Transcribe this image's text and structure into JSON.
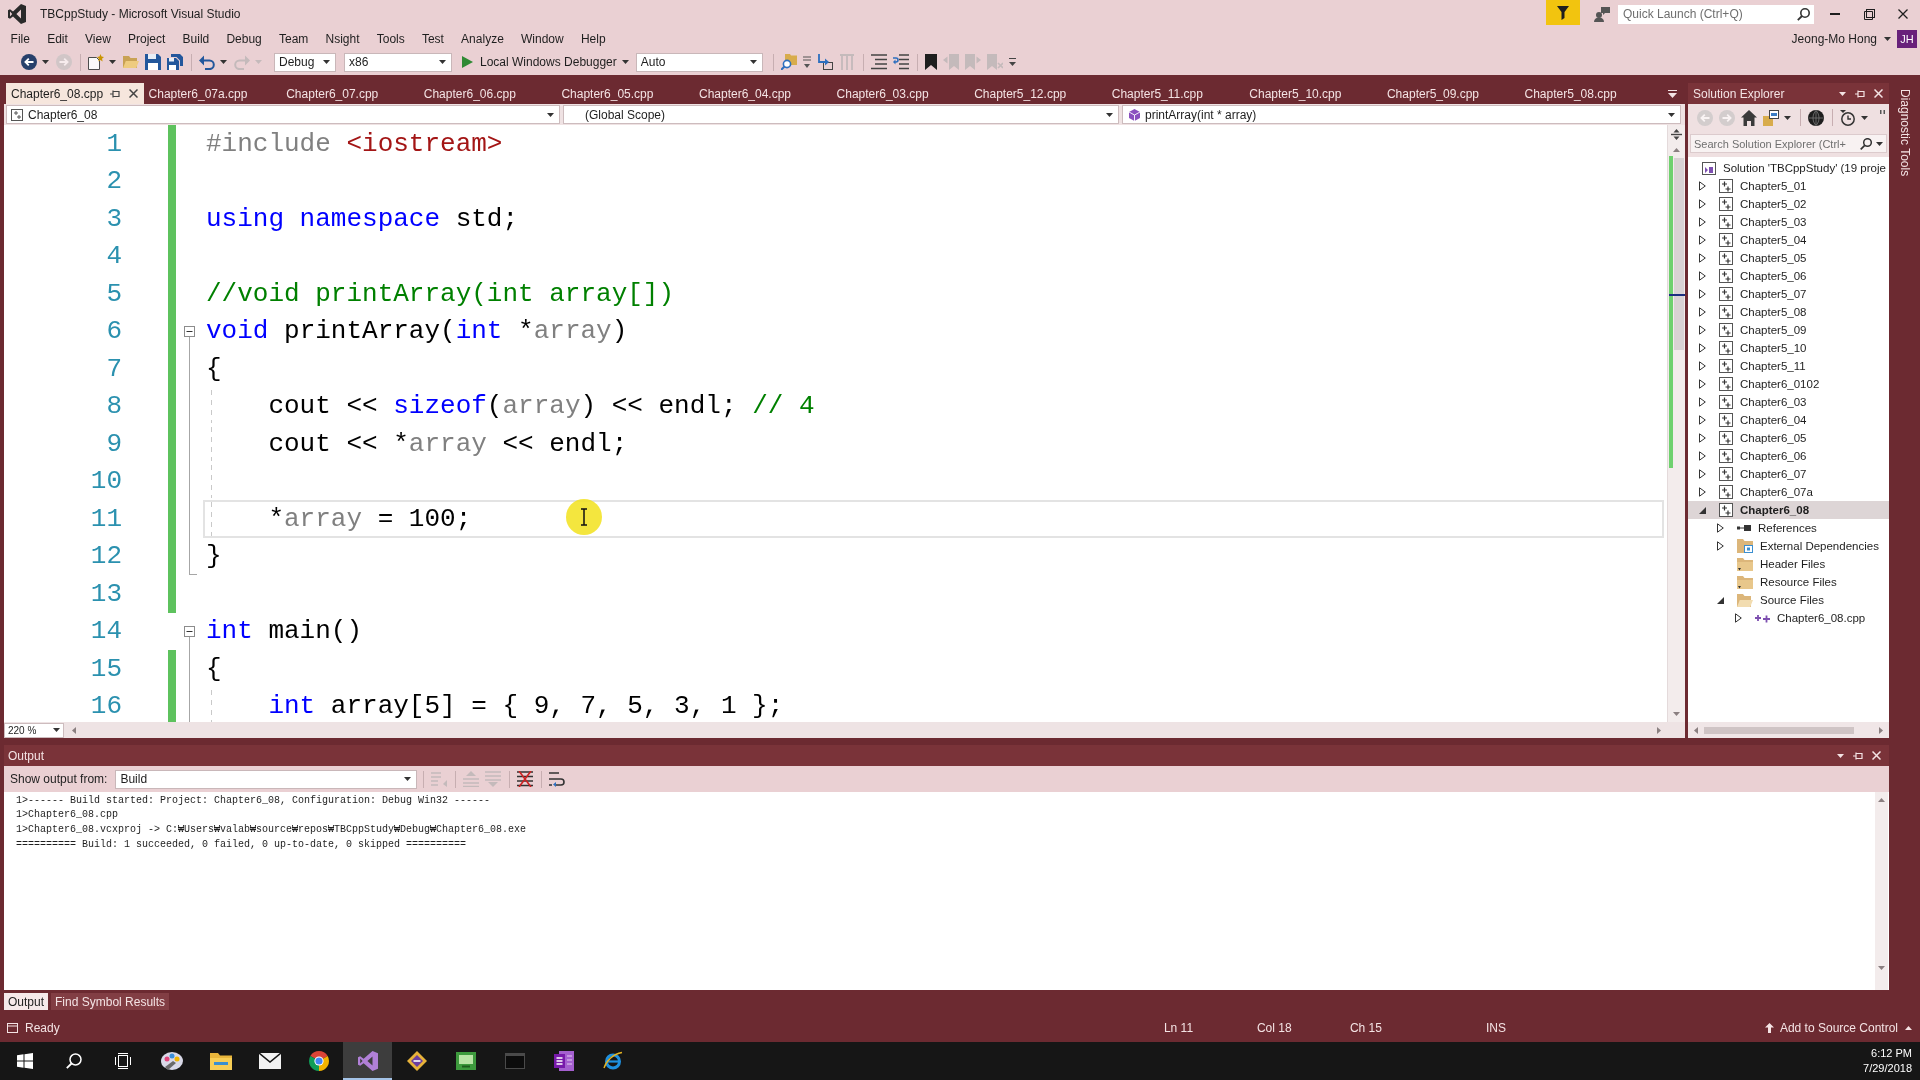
{
  "window": {
    "title": "TBCppStudy - Microsoft Visual Studio",
    "quick_launch": {
      "placeholder": "Quick Launch (Ctrl+Q)"
    }
  },
  "menu_bar": {
    "items": [
      "File",
      "Edit",
      "View",
      "Project",
      "Build",
      "Debug",
      "Team",
      "Nsight",
      "Tools",
      "Test",
      "Analyze",
      "Window",
      "Help"
    ],
    "account": {
      "name": "Jeong-Mo Hong",
      "initials": "JH"
    }
  },
  "toolbar": [
    {
      "kind": "back",
      "disabled": false,
      "dropdown": true
    },
    {
      "kind": "forward",
      "disabled": true,
      "dropdown": false
    },
    {
      "kind": "separator"
    },
    {
      "kind": "new-project",
      "disabled": false,
      "dropdown": true
    },
    {
      "kind": "open",
      "disabled": false,
      "dropdown": false
    },
    {
      "kind": "save",
      "disabled": false,
      "dropdown": false
    },
    {
      "kind": "save-all",
      "disabled": false,
      "dropdown": false
    },
    {
      "kind": "separator"
    },
    {
      "kind": "undo",
      "disabled": false,
      "dropdown": true
    },
    {
      "kind": "redo",
      "disabled": true,
      "dropdown": true
    },
    {
      "kind": "combo",
      "value": "Debug"
    },
    {
      "kind": "combo",
      "value": "x86"
    },
    {
      "kind": "run",
      "label": "Local Windows Debugger",
      "dropdown": true
    },
    {
      "kind": "combo",
      "value": "Auto"
    },
    {
      "kind": "separator"
    },
    {
      "kind": "find-in-files",
      "disabled": false,
      "dropdown": false
    },
    {
      "kind": "options",
      "disabled": false,
      "dropdown": false
    },
    {
      "kind": "step-into",
      "disabled": false,
      "dropdown": false
    },
    {
      "kind": "columns",
      "disabled": true,
      "dropdown": false
    },
    {
      "kind": "separator"
    },
    {
      "kind": "comment",
      "disabled": false,
      "dropdown": false
    },
    {
      "kind": "uncomment",
      "disabled": false,
      "dropdown": false
    },
    {
      "kind": "separator"
    },
    {
      "kind": "bookmark",
      "disabled": false,
      "dropdown": false
    },
    {
      "kind": "bookmark-prev",
      "disabled": true,
      "dropdown": false
    },
    {
      "kind": "bookmark-next",
      "disabled": true,
      "dropdown": false
    },
    {
      "kind": "bookmark-clear",
      "disabled": true,
      "dropdown": false
    },
    {
      "kind": "overflow",
      "disabled": false,
      "dropdown": false
    }
  ],
  "document_tabs": [
    {
      "label": "Chapter6_08.cpp",
      "selected": true
    },
    {
      "label": "Chapter6_07a.cpp",
      "selected": false
    },
    {
      "label": "Chapter6_07.cpp",
      "selected": false
    },
    {
      "label": "Chapter6_06.cpp",
      "selected": false
    },
    {
      "label": "Chapter6_05.cpp",
      "selected": false
    },
    {
      "label": "Chapter6_04.cpp",
      "selected": false
    },
    {
      "label": "Chapter6_03.cpp",
      "selected": false
    },
    {
      "label": "Chapter5_12.cpp",
      "selected": false
    },
    {
      "label": "Chapter5_11.cpp",
      "selected": false
    },
    {
      "label": "Chapter5_10.cpp",
      "selected": false
    },
    {
      "label": "Chapter5_09.cpp",
      "selected": false
    },
    {
      "label": "Chapter5_08.cpp",
      "selected": false
    }
  ],
  "navigation_bar": {
    "project": "Chapter6_08",
    "scope": "(Global Scope)",
    "member": "printArray(int * array)"
  },
  "editor": {
    "lines": [
      {
        "number": "1",
        "changed": true,
        "current": false,
        "tokens": [
          {
            "text": "#include",
            "kind": "preprocessor"
          },
          {
            "text": " <iostream>",
            "kind": "string"
          }
        ]
      },
      {
        "number": "2",
        "changed": true,
        "current": false
      },
      {
        "number": "3",
        "changed": true,
        "current": false,
        "tokens": [
          {
            "text": "using namespace",
            "kind": "keyword"
          },
          {
            "text": " std;",
            "kind": "plain"
          }
        ]
      },
      {
        "number": "4",
        "changed": true,
        "current": false
      },
      {
        "number": "5",
        "changed": true,
        "current": false,
        "tokens": [
          {
            "text": "//void printArray(int array[])",
            "kind": "comment"
          }
        ]
      },
      {
        "number": "6",
        "changed": true,
        "current": false,
        "expanded": true,
        "tokens": [
          {
            "text": "void",
            "kind": "keyword"
          },
          {
            "text": " printArray(",
            "kind": "plain"
          },
          {
            "text": "int",
            "kind": "keyword"
          },
          {
            "text": " *",
            "kind": "plain"
          },
          {
            "text": "array",
            "kind": "parameter"
          },
          {
            "text": ")",
            "kind": "plain"
          }
        ],
        "children": [
          {
            "number": "7",
            "changed": true,
            "current": false,
            "tokens": [
              {
                "text": "{",
                "kind": "plain"
              }
            ]
          },
          {
            "number": "8",
            "changed": true,
            "current": false,
            "tokens": [
              {
                "text": "    cout << ",
                "kind": "plain"
              },
              {
                "text": "sizeof",
                "kind": "keyword"
              },
              {
                "text": "(",
                "kind": "plain"
              },
              {
                "text": "array",
                "kind": "parameter"
              },
              {
                "text": ") << endl; ",
                "kind": "plain"
              },
              {
                "text": "// 4",
                "kind": "comment"
              }
            ]
          },
          {
            "number": "9",
            "changed": true,
            "current": false,
            "tokens": [
              {
                "text": "    cout << *",
                "kind": "plain"
              },
              {
                "text": "array",
                "kind": "parameter"
              },
              {
                "text": " << endl;",
                "kind": "plain"
              }
            ]
          },
          {
            "number": "10",
            "changed": true,
            "current": false
          },
          {
            "number": "11",
            "changed": true,
            "current": true,
            "tokens": [
              {
                "text": "    *",
                "kind": "plain"
              },
              {
                "text": "array",
                "kind": "parameter"
              },
              {
                "text": " = 100;",
                "kind": "plain"
              }
            ]
          },
          {
            "number": "12",
            "changed": true,
            "current": false,
            "tokens": [
              {
                "text": "}",
                "kind": "plain"
              }
            ]
          }
        ]
      },
      {
        "number": "13",
        "changed": true,
        "current": false
      },
      {
        "number": "14",
        "changed": false,
        "current": false,
        "expanded": true,
        "tokens": [
          {
            "text": "int",
            "kind": "keyword"
          },
          {
            "text": " main()",
            "kind": "plain"
          }
        ],
        "children": [
          {
            "number": "15",
            "changed": true,
            "current": false,
            "tokens": [
              {
                "text": "{",
                "kind": "plain"
              }
            ]
          },
          {
            "number": "16",
            "changed": true,
            "current": false,
            "tokens": [
              {
                "text": "    int",
                "kind": "keyword"
              },
              {
                "text": " array[5] = { 9, 7, 5, 3, 1 };",
                "kind": "plain"
              }
            ]
          }
        ]
      }
    ],
    "zoom": "220 %"
  },
  "solution_explorer": {
    "title": "Solution Explorer",
    "toolbar": [
      {
        "kind": "back",
        "disabled": true,
        "dropdown": false
      },
      {
        "kind": "forward",
        "disabled": true,
        "dropdown": false
      },
      {
        "kind": "home",
        "disabled": false,
        "dropdown": false
      },
      {
        "kind": "switch-views",
        "disabled": false,
        "dropdown": true
      },
      {
        "kind": "separator"
      },
      {
        "kind": "globe",
        "disabled": false,
        "dropdown": false
      },
      {
        "kind": "separator"
      },
      {
        "kind": "history",
        "disabled": false,
        "dropdown": true
      },
      {
        "kind": "grip",
        "disabled": false,
        "dropdown": false
      }
    ],
    "search": {
      "placeholder": "Search Solution Explorer (Ctrl+"
    },
    "tree": [
      {
        "label": "Solution 'TBCppStudy' (19 proje",
        "kind": "solution",
        "selected": false,
        "children": [
          {
            "label": "Chapter5_01",
            "kind": "project",
            "expanded": false,
            "selected": false,
            "startup": false
          },
          {
            "label": "Chapter5_02",
            "kind": "project",
            "expanded": false,
            "selected": false,
            "startup": false
          },
          {
            "label": "Chapter5_03",
            "kind": "project",
            "expanded": false,
            "selected": false,
            "startup": false
          },
          {
            "label": "Chapter5_04",
            "kind": "project",
            "expanded": false,
            "selected": false,
            "startup": false
          },
          {
            "label": "Chapter5_05",
            "kind": "project",
            "expanded": false,
            "selected": false,
            "startup": false
          },
          {
            "label": "Chapter5_06",
            "kind": "project",
            "expanded": false,
            "selected": false,
            "startup": false
          },
          {
            "label": "Chapter5_07",
            "kind": "project",
            "expanded": false,
            "selected": false,
            "startup": false
          },
          {
            "label": "Chapter5_08",
            "kind": "project",
            "expanded": false,
            "selected": false,
            "startup": false
          },
          {
            "label": "Chapter5_09",
            "kind": "project",
            "expanded": false,
            "selected": false,
            "startup": false
          },
          {
            "label": "Chapter5_10",
            "kind": "project",
            "expanded": false,
            "selected": false,
            "startup": false
          },
          {
            "label": "Chapter5_11",
            "kind": "project",
            "expanded": false,
            "selected": false,
            "startup": false
          },
          {
            "label": "Chapter6_0102",
            "kind": "project",
            "expanded": false,
            "selected": false,
            "startup": false
          },
          {
            "label": "Chapter6_03",
            "kind": "project",
            "expanded": false,
            "selected": false,
            "startup": false
          },
          {
            "label": "Chapter6_04",
            "kind": "project",
            "expanded": false,
            "selected": false,
            "startup": false
          },
          {
            "label": "Chapter6_05",
            "kind": "project",
            "expanded": false,
            "selected": false,
            "startup": false
          },
          {
            "label": "Chapter6_06",
            "kind": "project",
            "expanded": false,
            "selected": false,
            "startup": false
          },
          {
            "label": "Chapter6_07",
            "kind": "project",
            "expanded": false,
            "selected": false,
            "startup": false
          },
          {
            "label": "Chapter6_07a",
            "kind": "project",
            "expanded": false,
            "selected": false,
            "startup": false
          },
          {
            "label": "Chapter6_08",
            "kind": "project",
            "expanded": true,
            "selected": true,
            "startup": true,
            "children": [
              {
                "label": "References",
                "kind": "references",
                "expanded": false,
                "selected": false
              },
              {
                "label": "External Dependencies",
                "kind": "external-dependencies",
                "expanded": false,
                "selected": false
              },
              {
                "label": "Header Files",
                "kind": "folder",
                "selected": false
              },
              {
                "label": "Resource Files",
                "kind": "folder",
                "selected": false
              },
              {
                "label": "Source Files",
                "kind": "folder",
                "expanded": true,
                "selected": false,
                "children": [
                  {
                    "label": "Chapter6_08.cpp",
                    "kind": "cpp-file",
                    "expanded": false,
                    "selected": false
                  }
                ]
              }
            ]
          }
        ]
      }
    ]
  },
  "diagnostic_tools": {
    "label": "Diagnostic Tools"
  },
  "output": {
    "title": "Output",
    "source_label": "Show output from:",
    "source": "Build",
    "toolbar": [
      {
        "kind": "find-message",
        "disabled": true,
        "dropdown": false
      },
      {
        "kind": "separator"
      },
      {
        "kind": "previous-message",
        "disabled": true,
        "dropdown": false
      },
      {
        "kind": "next-message",
        "disabled": true,
        "dropdown": false
      },
      {
        "kind": "separator"
      },
      {
        "kind": "clear-all",
        "disabled": false,
        "dropdown": false
      },
      {
        "kind": "separator"
      },
      {
        "kind": "word-wrap",
        "disabled": false,
        "dropdown": false
      }
    ],
    "lines": [
      "1>------ Build started: Project: Chapter6_08, Configuration: Debug Win32 ------",
      "1>Chapter6_08.cpp",
      "1>Chapter6_08.vcxproj -> C:₩Users₩valab₩source₩repos₩TBCppStudy₩Debug₩Chapter6_08.exe",
      "========== Build: 1 succeeded, 0 failed, 0 up-to-date, 0 skipped =========="
    ]
  },
  "output_tabs": [
    {
      "label": "Output",
      "selected": true
    },
    {
      "label": "Find Symbol Results",
      "selected": false
    }
  ],
  "status_bar": {
    "message": "Ready",
    "line": "Ln 11",
    "column": "Col 18",
    "character": "Ch 15",
    "mode": "INS",
    "source_control": "Add to Source Control"
  },
  "taskbar": {
    "items": [
      {
        "kind": "start",
        "selected": false
      },
      {
        "kind": "search",
        "selected": false
      },
      {
        "kind": "task-view",
        "selected": false
      },
      {
        "kind": "paint",
        "selected": false
      },
      {
        "kind": "file-explorer",
        "selected": false
      },
      {
        "kind": "mail",
        "selected": false
      },
      {
        "kind": "browser",
        "selected": false
      },
      {
        "kind": "visual-studio",
        "selected": true
      },
      {
        "kind": "git",
        "selected": false
      },
      {
        "kind": "screen-app",
        "selected": false
      },
      {
        "kind": "console",
        "selected": false
      },
      {
        "kind": "notebook",
        "selected": false
      },
      {
        "kind": "web",
        "selected": false
      }
    ],
    "time": "6:12 PM",
    "date": "7/29/2018"
  }
}
